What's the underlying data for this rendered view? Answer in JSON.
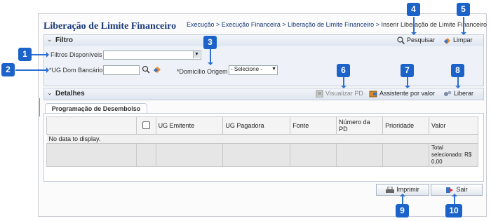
{
  "header": {
    "title": "Liberação de Limite Financeiro",
    "breadcrumb": [
      "Execução",
      "Execução Financeira",
      "Liberação de Limite Financeiro"
    ],
    "breadcrumb_sep": " > ",
    "breadcrumb_current": "Inserir Liberação de Limite Financeiro"
  },
  "filter": {
    "section_label": "Filtro",
    "search_button": "Pesquisar",
    "clear_button": "Limpar",
    "available_filters_label": "Filtros Disponíveis",
    "available_filters_value": "",
    "ug_label": "*UG Dom Bancário",
    "ug_value": "",
    "domicilio_label": "*Domicílio Origem",
    "domicilio_value": "- Selecione -"
  },
  "details": {
    "section_label": "Detalhes",
    "view_pd_button": "Visualizar PD",
    "assistant_button": "Assistente por valor",
    "release_button": "Liberar",
    "tab_label": "Programação de Desembolso",
    "columns": [
      "",
      "UG Emitente",
      "UG Pagadora",
      "Fonte",
      "Número da PD",
      "Prioridade",
      "Valor"
    ],
    "no_data": "No data to display.",
    "total_label": "Total selecionado: R$ 0,00"
  },
  "footer": {
    "print_button": "Imprimir",
    "exit_button": "Sair"
  },
  "callouts": [
    "1",
    "2",
    "3",
    "4",
    "5",
    "6",
    "7",
    "8",
    "9",
    "10"
  ],
  "colors": {
    "callout": "#1c63c9",
    "title": "#1a3a7a"
  }
}
